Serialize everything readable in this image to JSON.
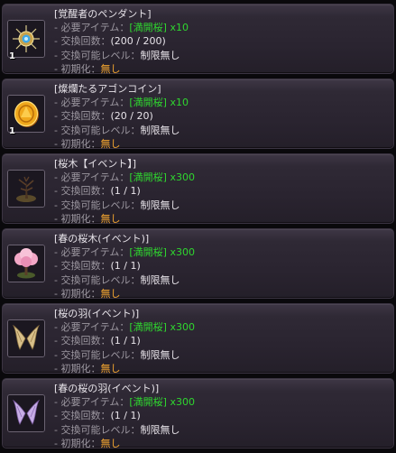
{
  "labels": {
    "required_item": "- 必要アイテム：",
    "exchange_count": "- 交換回数：",
    "exchange_level": "- 交換可能レベル：",
    "initialize": "- 初期化："
  },
  "items": [
    {
      "name": "[覚醒者のペンダント]",
      "icon": "awakener-pendant-icon",
      "quantity": "1",
      "required_item": "[満開桜]",
      "required_qty": "x10",
      "count": "(200 / 200)",
      "level": "制限無し",
      "reset": "無し"
    },
    {
      "name": "[燦爛たるアゴンコイン]",
      "icon": "agon-coin-icon",
      "quantity": "1",
      "required_item": "[満開桜]",
      "required_qty": "x10",
      "count": "(20 / 20)",
      "level": "制限無し",
      "reset": "無し"
    },
    {
      "name": "[桜木【イベント】]",
      "icon": "cherry-tree-icon",
      "quantity": "",
      "required_item": "[満開桜]",
      "required_qty": "x300",
      "count": "(1 / 1)",
      "level": "制限無し",
      "reset": "無し"
    },
    {
      "name": "[春の桜木(イベント)]",
      "icon": "spring-cherry-tree-icon",
      "quantity": "",
      "required_item": "[満開桜]",
      "required_qty": "x300",
      "count": "(1 / 1)",
      "level": "制限無し",
      "reset": "無し"
    },
    {
      "name": "[桜の羽(イベント)]",
      "icon": "cherry-wings-icon",
      "quantity": "",
      "required_item": "[満開桜]",
      "required_qty": "x300",
      "count": "(1 / 1)",
      "level": "制限無し",
      "reset": "無し"
    },
    {
      "name": "[春の桜の羽(イベント)]",
      "icon": "spring-cherry-wings-icon",
      "quantity": "",
      "required_item": "[満開桜]",
      "required_qty": "x300",
      "count": "(1 / 1)",
      "level": "制限無し",
      "reset": "無し"
    }
  ]
}
